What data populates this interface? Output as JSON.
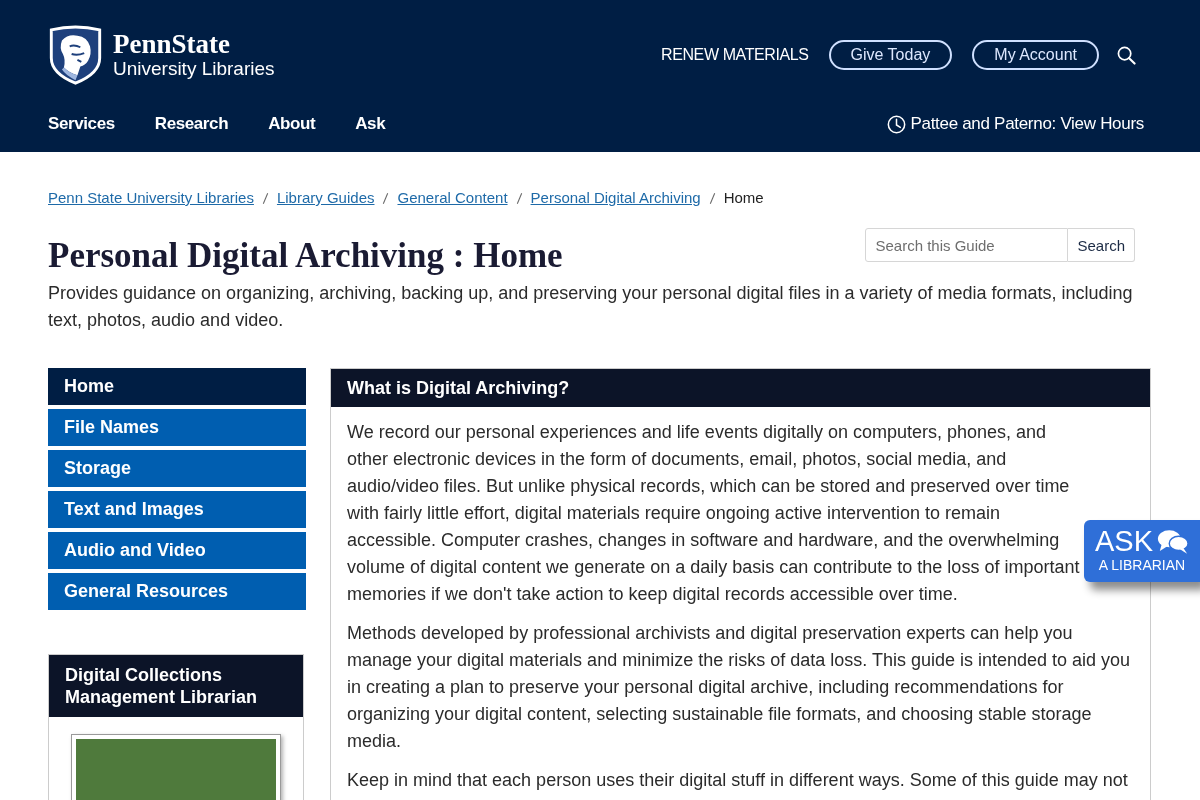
{
  "header": {
    "logo": {
      "wordmark": "PennState",
      "subtitle": "University Libraries"
    },
    "utility_links": [
      {
        "label": "RENEW MATERIALS",
        "kind": "link"
      },
      {
        "label": "Give Today",
        "kind": "pill"
      },
      {
        "label": "My Account",
        "kind": "pill"
      }
    ],
    "nav": [
      {
        "label": "Services"
      },
      {
        "label": "Research"
      },
      {
        "label": "About"
      },
      {
        "label": "Ask"
      }
    ],
    "hours_link": "Pattee and Paterno: View Hours"
  },
  "breadcrumb": [
    {
      "label": "Penn State University Libraries",
      "current": false
    },
    {
      "label": "Library Guides",
      "current": false
    },
    {
      "label": "General Content",
      "current": false
    },
    {
      "label": "Personal Digital Archiving",
      "current": false
    },
    {
      "label": "Home",
      "current": true
    }
  ],
  "page": {
    "title": "Personal Digital Archiving : Home",
    "description": "Provides guidance on organizing, archiving, backing up, and preserving your personal digital files in a variety of media formats, including text, photos, audio and video."
  },
  "guide_search": {
    "placeholder": "Search this Guide",
    "button": "Search"
  },
  "guide_nav": [
    {
      "label": "Home",
      "selected": true
    },
    {
      "label": "File Names",
      "selected": false
    },
    {
      "label": "Storage",
      "selected": false
    },
    {
      "label": "Text and Images",
      "selected": false
    },
    {
      "label": "Audio and Video",
      "selected": false
    },
    {
      "label": "General Resources",
      "selected": false
    }
  ],
  "profile_box": {
    "title": "Digital Collections Management Librarian"
  },
  "content_box": {
    "title": "What is Digital Archiving?",
    "paragraphs": [
      "We record our personal experiences and life events digitally on computers, phones, and other electronic devices in the form of documents, email, photos, social media, and audio/video files. But unlike physical records, which can be stored and preserved over time with fairly little effort, digital materials require ongoing active intervention to remain accessible. Computer crashes, changes in software and hardware, and the overwhelming volume of digital content we generate on a daily basis can contribute to the loss of important memories if we don't take action to keep digital records accessible over time.",
      "Methods developed by professional archivists and digital preservation experts can help you manage your digital materials and minimize the risks of data loss. This guide is intended to aid you in creating a plan to preserve your personal digital archive, including recommendations for organizing your digital content, selecting sustainable file formats, and choosing stable storage media.",
      "Keep in mind that each person uses their digital stuff in different ways. Some of this guide may not"
    ]
  },
  "ask_widget": {
    "title": "ASK",
    "subtitle": "A LIBRARIAN"
  }
}
